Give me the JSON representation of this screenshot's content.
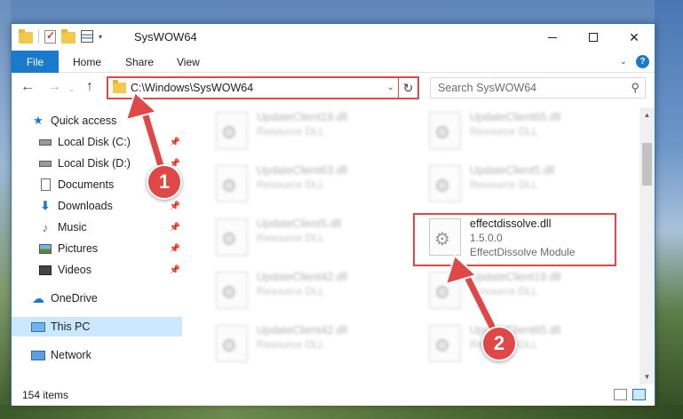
{
  "window": {
    "title": "SysWOW64"
  },
  "ribbon": {
    "file": "File",
    "home": "Home",
    "share": "Share",
    "view": "View",
    "help": "?"
  },
  "address": {
    "path": "C:\\Windows\\SysWOW64"
  },
  "search": {
    "placeholder": "Search SysWOW64"
  },
  "sidebar": {
    "items": [
      {
        "label": "Quick access",
        "icon": "star-icon"
      },
      {
        "label": "Local Disk (C:)",
        "icon": "drive-icon",
        "pinned": true
      },
      {
        "label": "Local Disk (D:)",
        "icon": "drive-icon",
        "pinned": true
      },
      {
        "label": "Documents",
        "icon": "document-icon",
        "pinned": true
      },
      {
        "label": "Downloads",
        "icon": "download-icon",
        "pinned": true
      },
      {
        "label": "Music",
        "icon": "music-icon",
        "pinned": true
      },
      {
        "label": "Pictures",
        "icon": "picture-icon",
        "pinned": true
      },
      {
        "label": "Videos",
        "icon": "video-icon",
        "pinned": true
      },
      {
        "label": "OneDrive",
        "icon": "cloud-icon"
      },
      {
        "label": "This PC",
        "icon": "computer-icon",
        "selected": true
      },
      {
        "label": "Network",
        "icon": "network-icon"
      }
    ]
  },
  "files": [
    {
      "name": "UpdateClient19.dll",
      "desc": "Resource DLL"
    },
    {
      "name": "UpdateClient65.dll",
      "desc": "Resource DLL"
    },
    {
      "name": "UpdateClient63.dll",
      "desc": "Resource DLL"
    },
    {
      "name": "UpdateClient5.dll",
      "desc": "Resource DLL"
    },
    {
      "name": "UpdateClient5.dll",
      "desc": "Resource DLL"
    },
    {
      "name": "effectdissolve.dll",
      "version": "1.5.0.0",
      "desc": "EffectDissolve Module"
    },
    {
      "name": "UpdateClient42.dll",
      "desc": "Resource DLL"
    },
    {
      "name": "UpdateClient19.dll",
      "desc": "Resource DLL"
    },
    {
      "name": "UpdateClient42.dll",
      "desc": "Resource DLL"
    },
    {
      "name": "UpdateClient65.dll",
      "desc": "Resource DLL"
    }
  ],
  "status": {
    "count": "154 items"
  },
  "annotations": {
    "step1": "1",
    "step2": "2",
    "color": "#e04848"
  }
}
